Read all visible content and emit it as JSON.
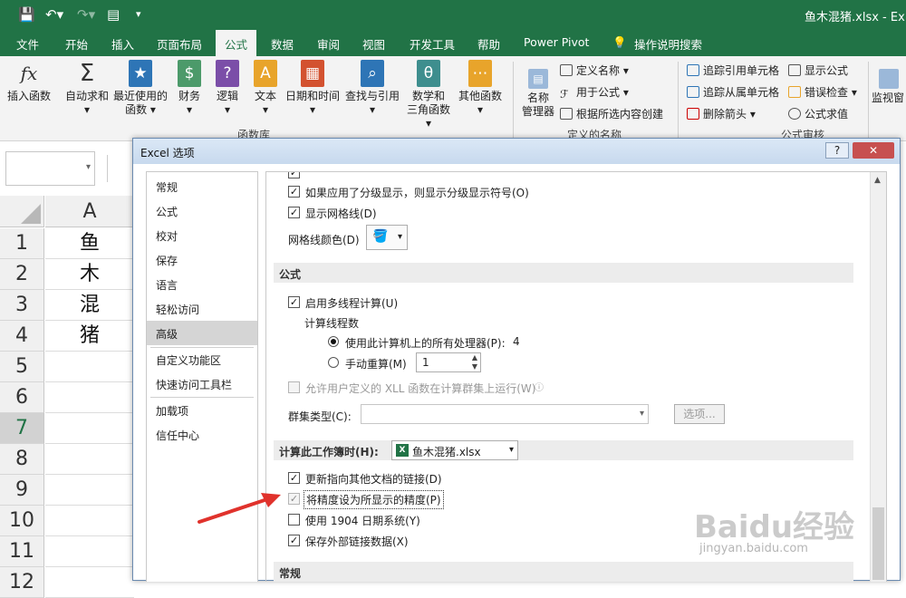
{
  "titlebar": {
    "filename": "鱼木混猪.xlsx - Ex"
  },
  "tabs": [
    {
      "label": "文件"
    },
    {
      "label": "开始"
    },
    {
      "label": "插入"
    },
    {
      "label": "页面布局"
    },
    {
      "label": "公式"
    },
    {
      "label": "数据"
    },
    {
      "label": "审阅"
    },
    {
      "label": "视图"
    },
    {
      "label": "开发工具"
    },
    {
      "label": "帮助"
    },
    {
      "label": "Power Pivot"
    },
    {
      "label": "操作说明搜索"
    }
  ],
  "ribbon": {
    "insert_function": "插入函数",
    "autosum": "自动求和",
    "recent_1": "最近使用的",
    "recent_2": "函数",
    "financial": "财务",
    "logical": "逻辑",
    "text": "文本",
    "datetime": "日期和时间",
    "lookup": "查找与引用",
    "math_1": "数学和",
    "math_2": "三角函数",
    "other": "其他函数",
    "group_library": "函数库",
    "name_mgr_1": "名称",
    "name_mgr_2": "管理器",
    "define_name": "定义名称",
    "use_in_formula": "用于公式",
    "create_from_sel": "根据所选内容创建",
    "group_names": "定义的名称",
    "trace_precedents": "追踪引用单元格",
    "trace_dependents": "追踪从属单元格",
    "remove_arrows": "删除箭头",
    "show_formulas": "显示公式",
    "error_checking": "错误检查",
    "evaluate": "公式求值",
    "group_audit": "公式审核",
    "watch": "监视窗"
  },
  "sheet": {
    "col_a": "A",
    "rows": [
      {
        "num": "1",
        "value": "鱼"
      },
      {
        "num": "2",
        "value": "木"
      },
      {
        "num": "3",
        "value": "混"
      },
      {
        "num": "4",
        "value": "猪"
      },
      {
        "num": "5",
        "value": ""
      },
      {
        "num": "6",
        "value": ""
      },
      {
        "num": "7",
        "value": ""
      },
      {
        "num": "8",
        "value": ""
      },
      {
        "num": "9",
        "value": ""
      },
      {
        "num": "10",
        "value": ""
      },
      {
        "num": "11",
        "value": ""
      },
      {
        "num": "12",
        "value": ""
      }
    ]
  },
  "dialog": {
    "title": "Excel 选项",
    "help": "?",
    "close": "✕",
    "nav": [
      {
        "label": "常规"
      },
      {
        "label": "公式"
      },
      {
        "label": "校对"
      },
      {
        "label": "保存"
      },
      {
        "label": "语言"
      },
      {
        "label": "轻松访问"
      },
      {
        "label": "高级"
      },
      {
        "label": "自定义功能区"
      },
      {
        "label": "快速访问工具栏"
      },
      {
        "label": "加载项"
      },
      {
        "label": "信任中心"
      }
    ],
    "opt_outline": "如果应用了分级显示，则显示分级显示符号(O)",
    "opt_gridlines": "显示网格线(D)",
    "grid_color_label": "网格线颜色(D)",
    "section_formulas": "公式",
    "opt_multithread": "启用多线程计算(U)",
    "threads_label": "计算线程数",
    "opt_all_processors": "使用此计算机上的所有处理器(P):",
    "processors_count": "4",
    "opt_manual": "手动重算(M)",
    "manual_value": "1",
    "opt_xll": "允许用户定义的 XLL 函数在计算群集上运行(W)",
    "cluster_label": "群集类型(C):",
    "options_button": "选项...",
    "calc_workbook_label": "计算此工作簿时(H):",
    "workbook_name": "鱼木混猪.xlsx",
    "opt_update_links": "更新指向其他文档的链接(D)",
    "opt_precision": "将精度设为所显示的精度(P)",
    "opt_1904": "使用 1904 日期系统(Y)",
    "opt_save_links": "保存外部链接数据(X)",
    "section_general": "常规"
  },
  "watermark": {
    "brand": "Baidu经验",
    "url": "jingyan.baidu.com"
  },
  "colors": {
    "excel_green": "#217346",
    "arrow_red": "#e0322c"
  }
}
